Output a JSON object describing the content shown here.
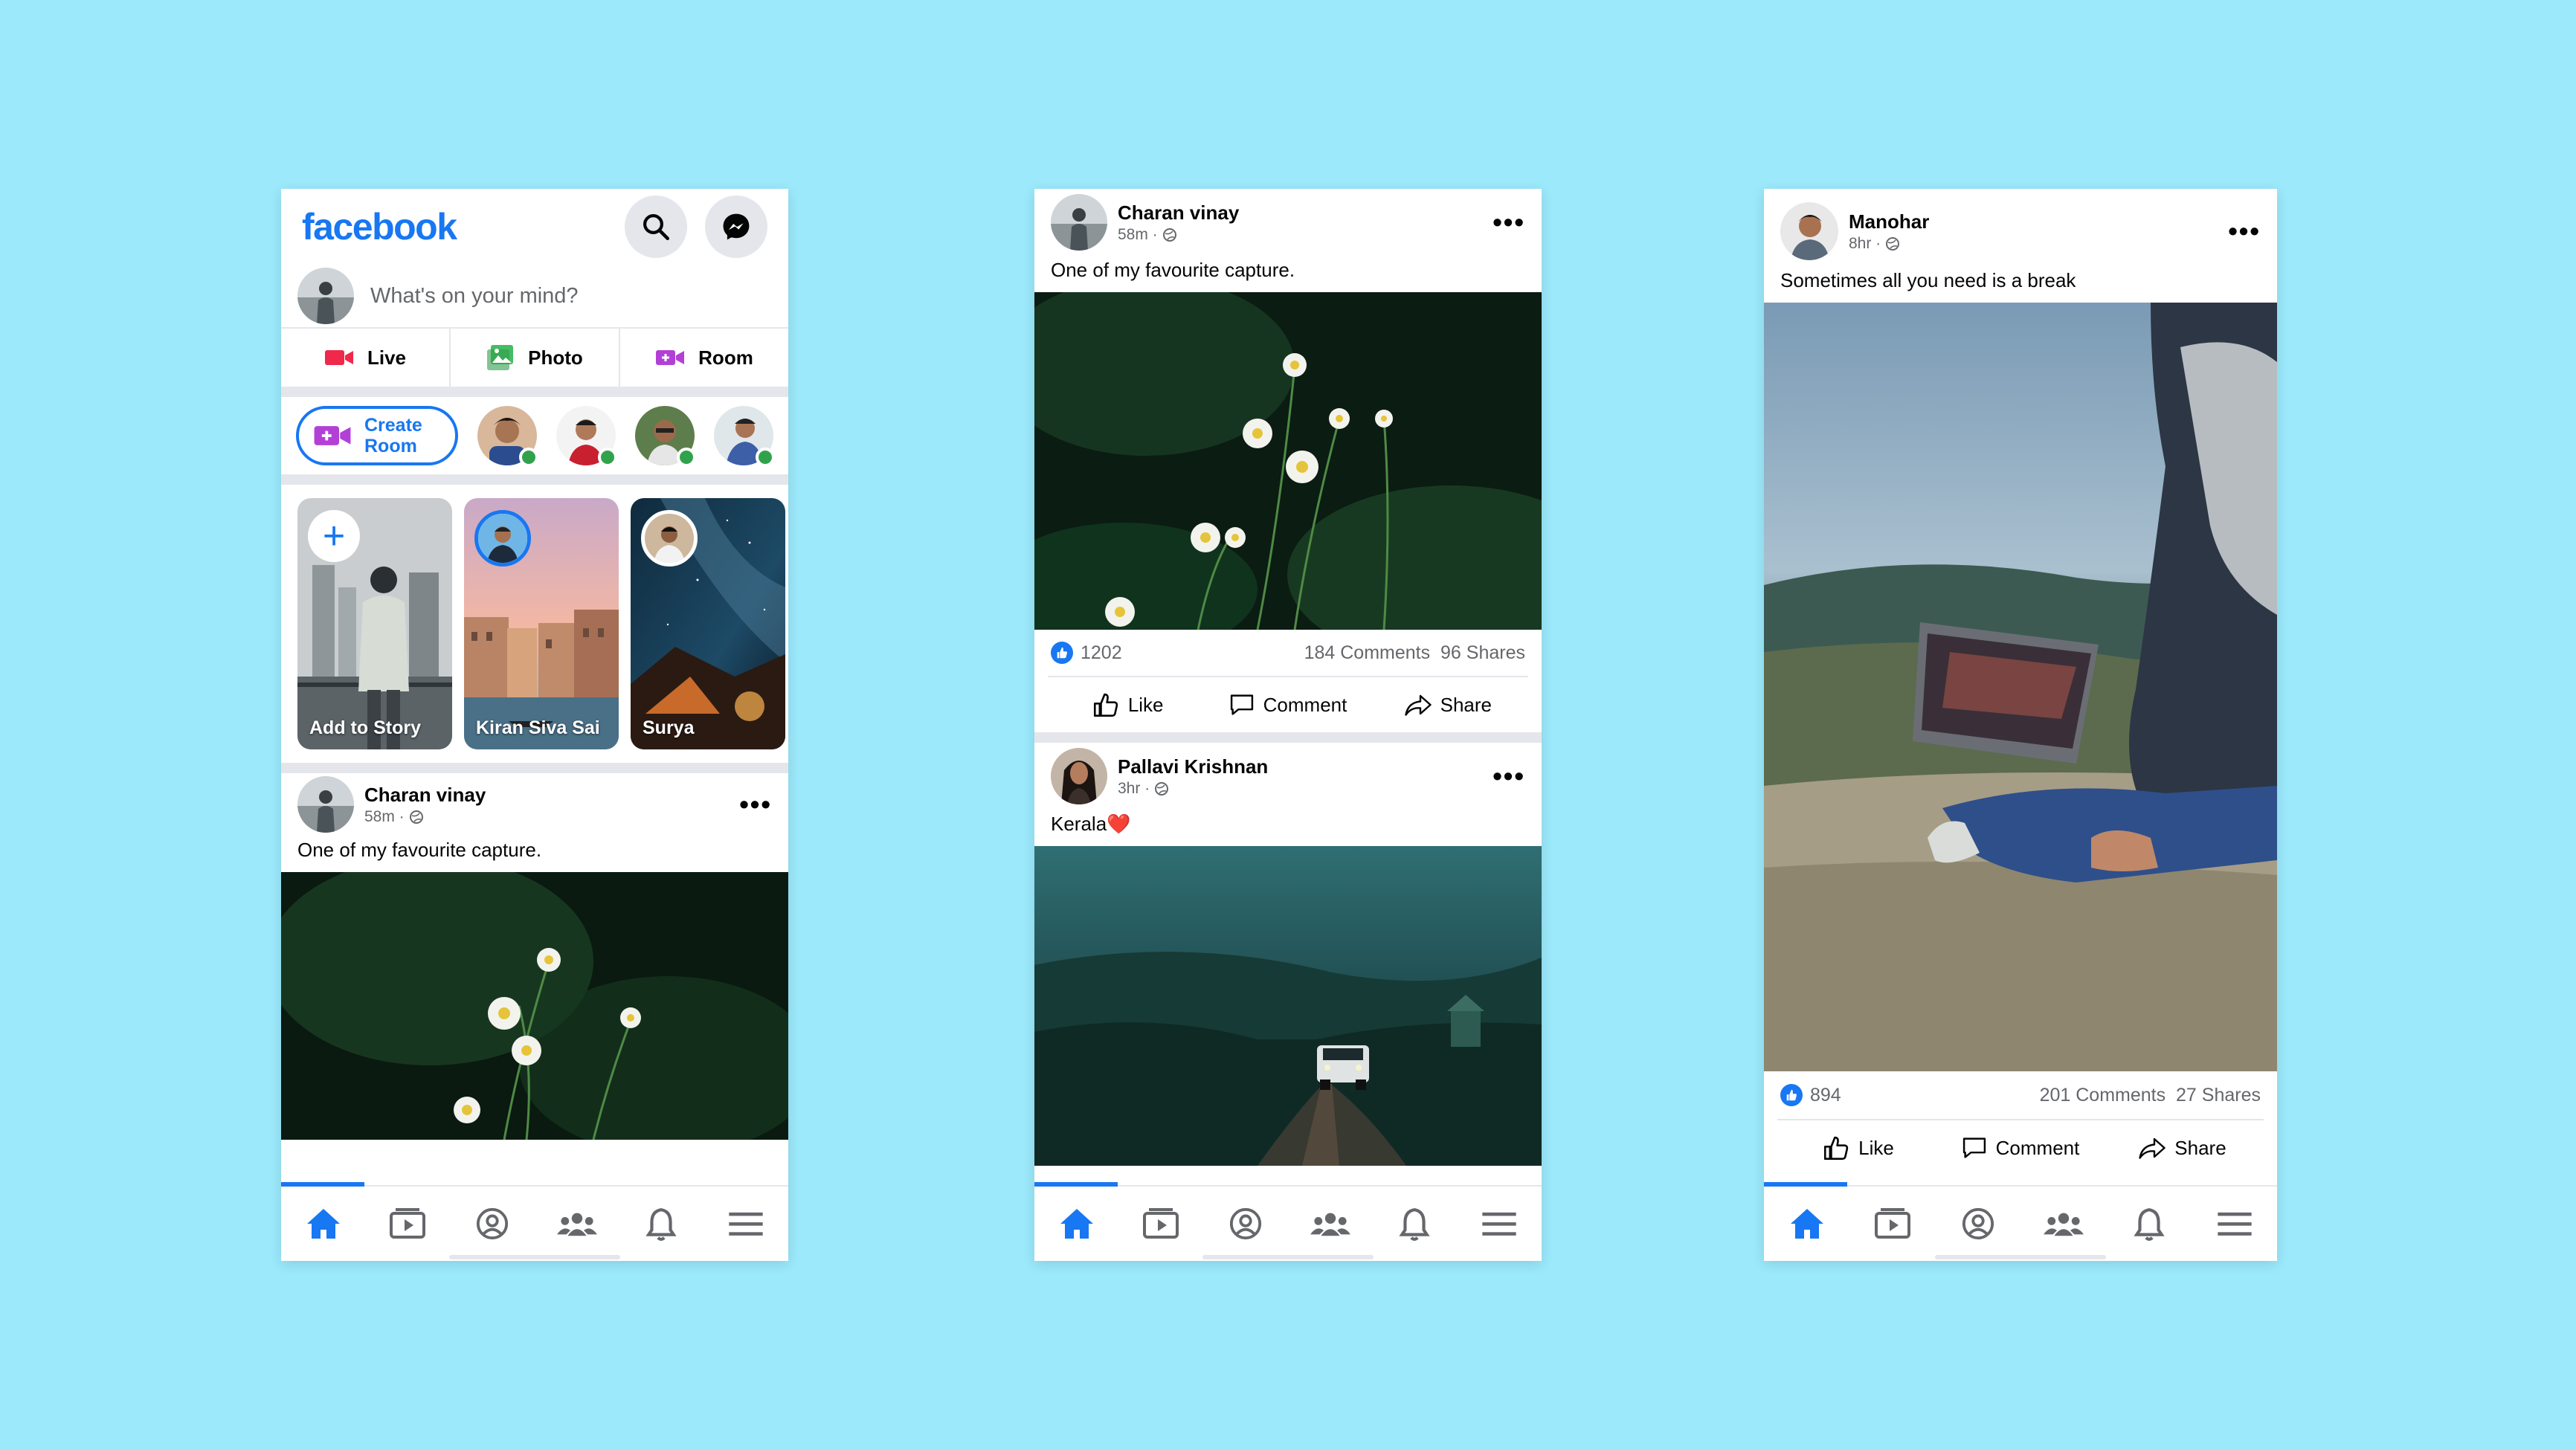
{
  "colors": {
    "background": "#9be9fb",
    "accent": "#1877f2",
    "online": "#31a24c",
    "live": "#f02849",
    "photo": "#45bd62",
    "room": "#b340d6"
  },
  "screen1": {
    "logo": "facebook",
    "composer_placeholder": "What's on your mind?",
    "composer_actions": [
      {
        "label": "Live",
        "icon": "video-camera-icon"
      },
      {
        "label": "Photo",
        "icon": "photo-icon"
      },
      {
        "label": "Room",
        "icon": "room-icon"
      }
    ],
    "create_room_line1": "Create",
    "create_room_line2": "Room",
    "stories": [
      {
        "name": "Add to Story"
      },
      {
        "name": "Kiran Siva Sai"
      },
      {
        "name": "Surya"
      }
    ],
    "post": {
      "author": "Charan vinay",
      "time": "58m ·",
      "caption": "One of my favourite capture."
    }
  },
  "screen2": {
    "post1": {
      "author": "Charan vinay",
      "time": "58m ·",
      "caption": "One of my favourite capture.",
      "likes": "1202",
      "comments": "184 Comments",
      "shares": "96 Shares"
    },
    "post2": {
      "author": "Pallavi Krishnan",
      "time": "3hr ·",
      "caption": "Kerala❤️"
    }
  },
  "screen3": {
    "post": {
      "author": "Manohar",
      "time": "8hr ·",
      "caption": "Sometimes all you need is a break",
      "likes": "894",
      "comments": "201 Comments",
      "shares": "27 Shares"
    }
  },
  "actions": {
    "like": "Like",
    "comment": "Comment",
    "share": "Share"
  },
  "bottom_nav": [
    "home-icon",
    "watch-icon",
    "profile-icon",
    "groups-icon",
    "notifications-icon",
    "menu-icon"
  ]
}
